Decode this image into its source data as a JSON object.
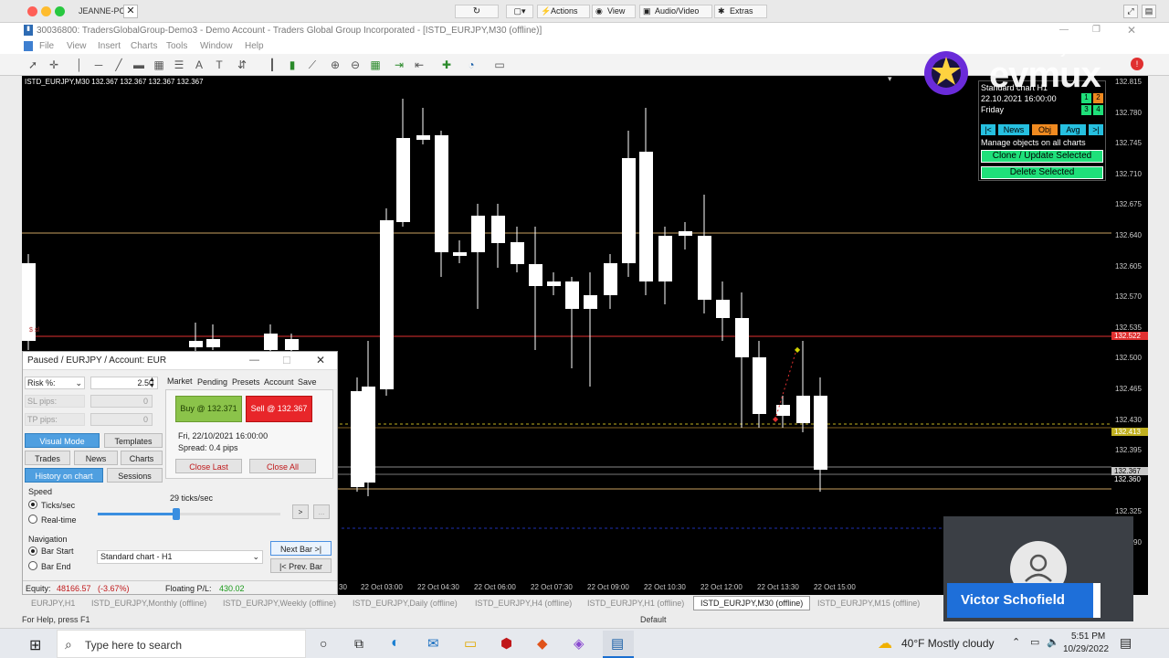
{
  "remote": {
    "pc_name": "JEANNE-PC",
    "actions": "Actions",
    "view": "View",
    "audio": "Audio/Video",
    "extras": "Extras"
  },
  "window": {
    "title": "30036800: TradersGlobalGroup-Demo3 - Demo Account - Traders Global Group Incorporated - [ISTD_EURJPY,M30 (offline)]"
  },
  "menu": [
    "File",
    "View",
    "Insert",
    "Charts",
    "Tools",
    "Window",
    "Help"
  ],
  "chart": {
    "label": "ISTD_EURJPY,M30  132.367 132.367 132.367 132.367",
    "small_label": "$ sl"
  },
  "axis_ticks": [
    "132.815",
    "132.780",
    "132.745",
    "132.710",
    "132.675",
    "132.640",
    "132.605",
    "132.570",
    "132.535",
    "132.500",
    "132.465",
    "132.430",
    "132.395",
    "132.360",
    "132.325",
    "132.290"
  ],
  "price_tags": {
    "red": "132.522",
    "green": "132.413",
    "current": "132.367",
    "below": "132.360"
  },
  "time_labels": [
    "30",
    "22 Oct 03:00",
    "22 Oct 04:30",
    "22 Oct 06:00",
    "22 Oct 07:30",
    "22 Oct 09:00",
    "22 Oct 10:30",
    "22 Oct 12:00",
    "22 Oct 13:30",
    "22 Oct 15:00"
  ],
  "panel": {
    "title": "Paused / EURJPY / Account: EUR",
    "risk_label": "Risk %:",
    "risk_value": "2.50",
    "sl_label": "SL pips:",
    "sl_value": "0",
    "tp_label": "TP pips:",
    "tp_value": "0",
    "visual_mode": "Visual Mode",
    "templates": "Templates",
    "trades": "Trades",
    "news": "News",
    "charts": "Charts",
    "history": "History on chart",
    "sessions": "Sessions",
    "tabs": [
      "Market",
      "Pending",
      "Presets",
      "Account",
      "Save"
    ],
    "buy": "Buy @ 132.371",
    "sell": "Sell @ 132.367",
    "datetime": "Fri, 22/10/2021  16:00:00",
    "spread": "Spread: 0.4 pips",
    "close_last": "Close Last",
    "close_all": "Close All",
    "speed_label": "Speed",
    "speed_value": "29 ticks/sec",
    "ticks_sec": "Ticks/sec",
    "real_time": "Real-time",
    "speed_fraction": 0.43,
    "play": ">",
    "more": "...",
    "nav_label": "Navigation",
    "bar_start": "Bar Start",
    "bar_end": "Bar End",
    "chart_select": "Standard chart - H1",
    "next_bar": "Next Bar >|",
    "prev_bar": "|< Prev. Bar",
    "equity_label": "Equity:",
    "equity_value": "48166.57",
    "equity_pct": "(-3.67%)",
    "floating_label": "Floating P/L:",
    "floating_value": "430.02"
  },
  "overlay": {
    "head": "Standard chart H1",
    "date": "22.10.2021   16:00:00",
    "day": "Friday",
    "nums": [
      "1",
      "2",
      "3",
      "4"
    ],
    "nav": [
      "|<",
      "News",
      "Obj",
      "Avg",
      ">|"
    ],
    "manage": "Manage objects on all charts",
    "clone": "Clone / Update Selected",
    "delete": "Delete Selected"
  },
  "watermark": {
    "powered": "Powered by",
    "brand": "evmux"
  },
  "presenter": {
    "name": "Victor Schofield"
  },
  "chart_tabs": [
    "EURJPY,H1",
    "ISTD_EURJPY,Monthly (offline)",
    "ISTD_EURJPY,Weekly (offline)",
    "ISTD_EURJPY,Daily (offline)",
    "ISTD_EURJPY,H4 (offline)",
    "ISTD_EURJPY,H1 (offline)",
    "ISTD_EURJPY,M30 (offline)",
    "ISTD_EURJPY,M15 (offline)"
  ],
  "status": {
    "help": "For Help, press F1",
    "profile": "Default"
  },
  "taskbar": {
    "search": "Type here to search",
    "weather": "40°F  Mostly cloudy",
    "time": "5:51 PM",
    "date": "10/29/2022"
  },
  "colors": {
    "buy": "#8bc34a",
    "sell": "#e8262a",
    "blue_button": "#4f9fe0",
    "overlay_button": "#1fe07a"
  }
}
